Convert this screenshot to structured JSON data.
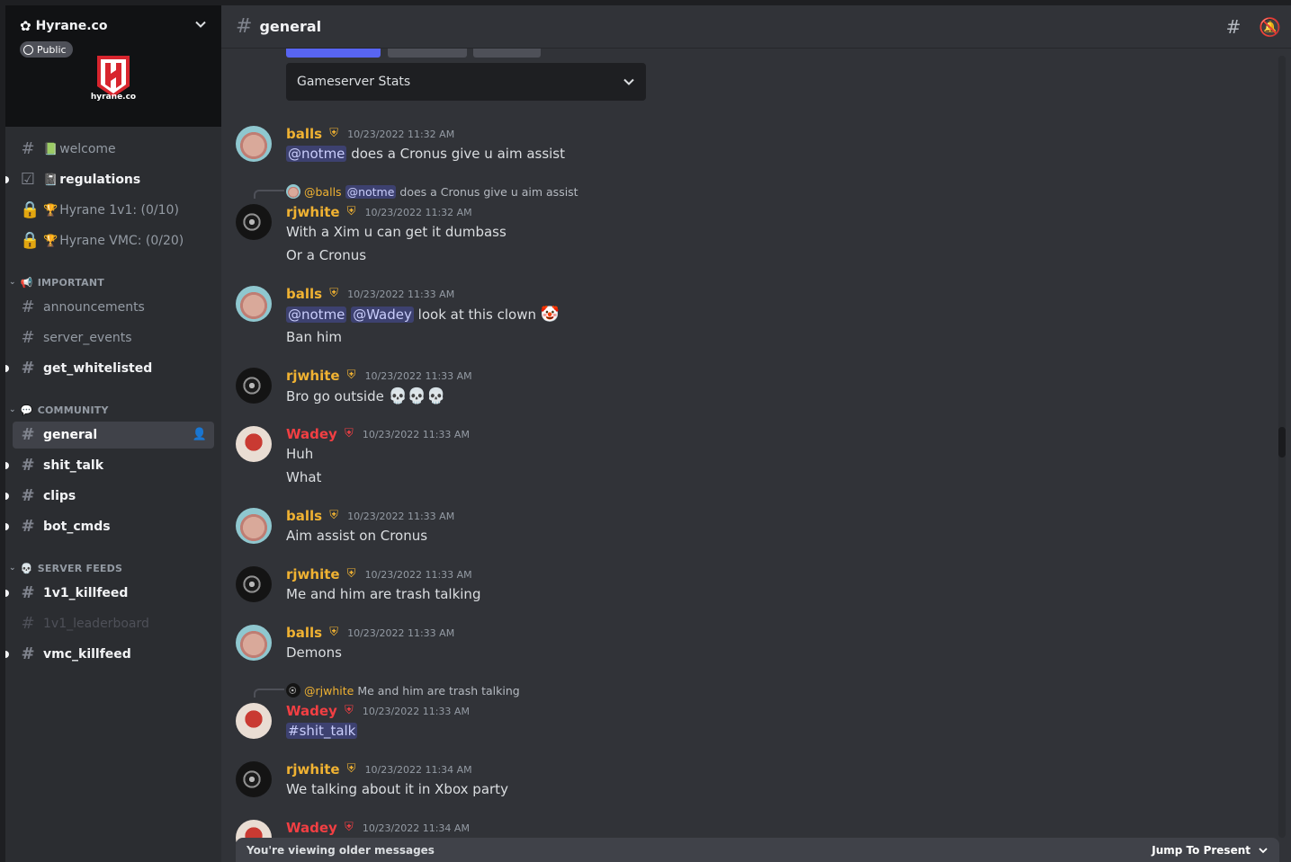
{
  "guild": {
    "name": "Hyrane.co",
    "public_label": "Public",
    "logo_text": "hyrane.co"
  },
  "sidebar": {
    "top_channels": [
      {
        "name": "welcome",
        "emoji": "📗"
      },
      {
        "name": "regulations",
        "emoji": "📓"
      },
      {
        "name": "Hyrane 1v1: (0/10)",
        "emoji": "🏆"
      },
      {
        "name": "Hyrane VMC: (0/20)",
        "emoji": "🏆"
      }
    ],
    "categories": [
      {
        "label": "IMPORTANT",
        "emoji": "📢",
        "channels": [
          "announcements",
          "server_events",
          "get_whitelisted"
        ]
      },
      {
        "label": "COMMUNITY",
        "emoji": "💬",
        "channels": [
          "general",
          "shit_talk",
          "clips",
          "bot_cmds"
        ]
      },
      {
        "label": "SERVER FEEDS",
        "emoji": "💀",
        "channels": [
          "1v1_killfeed",
          "1v1_leaderboard",
          "vmc_killfeed"
        ]
      }
    ]
  },
  "channel": {
    "title": "general"
  },
  "embed": {
    "select_value": "Gameserver Stats",
    "button_color": "#5865f2"
  },
  "messages": [
    {
      "author": "balls",
      "time": "10/23/2022 11:32 AM",
      "mention": "@notme",
      "text": "does a Cronus give u aim assist"
    },
    {
      "reply": {
        "author": "@balls",
        "mention": "@notme",
        "text": "does a Cronus give u aim assist"
      },
      "author": "rjwhite",
      "time": "10/23/2022 11:32 AM",
      "lines": [
        "With a Xim u can get it dumbass",
        "Or a Cronus"
      ]
    },
    {
      "author": "balls",
      "time": "10/23/2022 11:33 AM",
      "mention1": "@notme",
      "mention2": "@Wadey",
      "text": "look at this clown",
      "emoji": "🤡",
      "line2": "Ban him"
    },
    {
      "author": "rjwhite",
      "time": "10/23/2022 11:33 AM",
      "text": "Bro go outside",
      "emoji": "💀💀💀"
    },
    {
      "author": "Wadey",
      "time": "10/23/2022 11:33 AM",
      "lines": [
        "Huh",
        "What"
      ]
    },
    {
      "author": "balls",
      "time": "10/23/2022 11:33 AM",
      "text": "Aim assist on Cronus"
    },
    {
      "author": "rjwhite",
      "time": "10/23/2022 11:33 AM",
      "text": "Me and him are trash talking"
    },
    {
      "author": "balls",
      "time": "10/23/2022 11:33 AM",
      "text": "Demons"
    },
    {
      "reply": {
        "author": "@rjwhite",
        "text": "Me and him are trash talking"
      },
      "author": "Wadey",
      "time": "10/23/2022 11:33 AM",
      "channel_link": "#shit_talk"
    },
    {
      "author": "rjwhite",
      "time": "10/23/2022 11:34 AM",
      "text": "We talking about it in Xbox party"
    },
    {
      "author": "Wadey",
      "time": "10/23/2022 11:34 AM"
    }
  ],
  "older_bar": {
    "text": "You're viewing older messages",
    "jump_label": "Jump To Present"
  },
  "colors": {
    "gold_role": "#f0b232",
    "red_role": "#f23f43",
    "mention_bg": "#3c4270",
    "blurple": "#5865f2"
  }
}
